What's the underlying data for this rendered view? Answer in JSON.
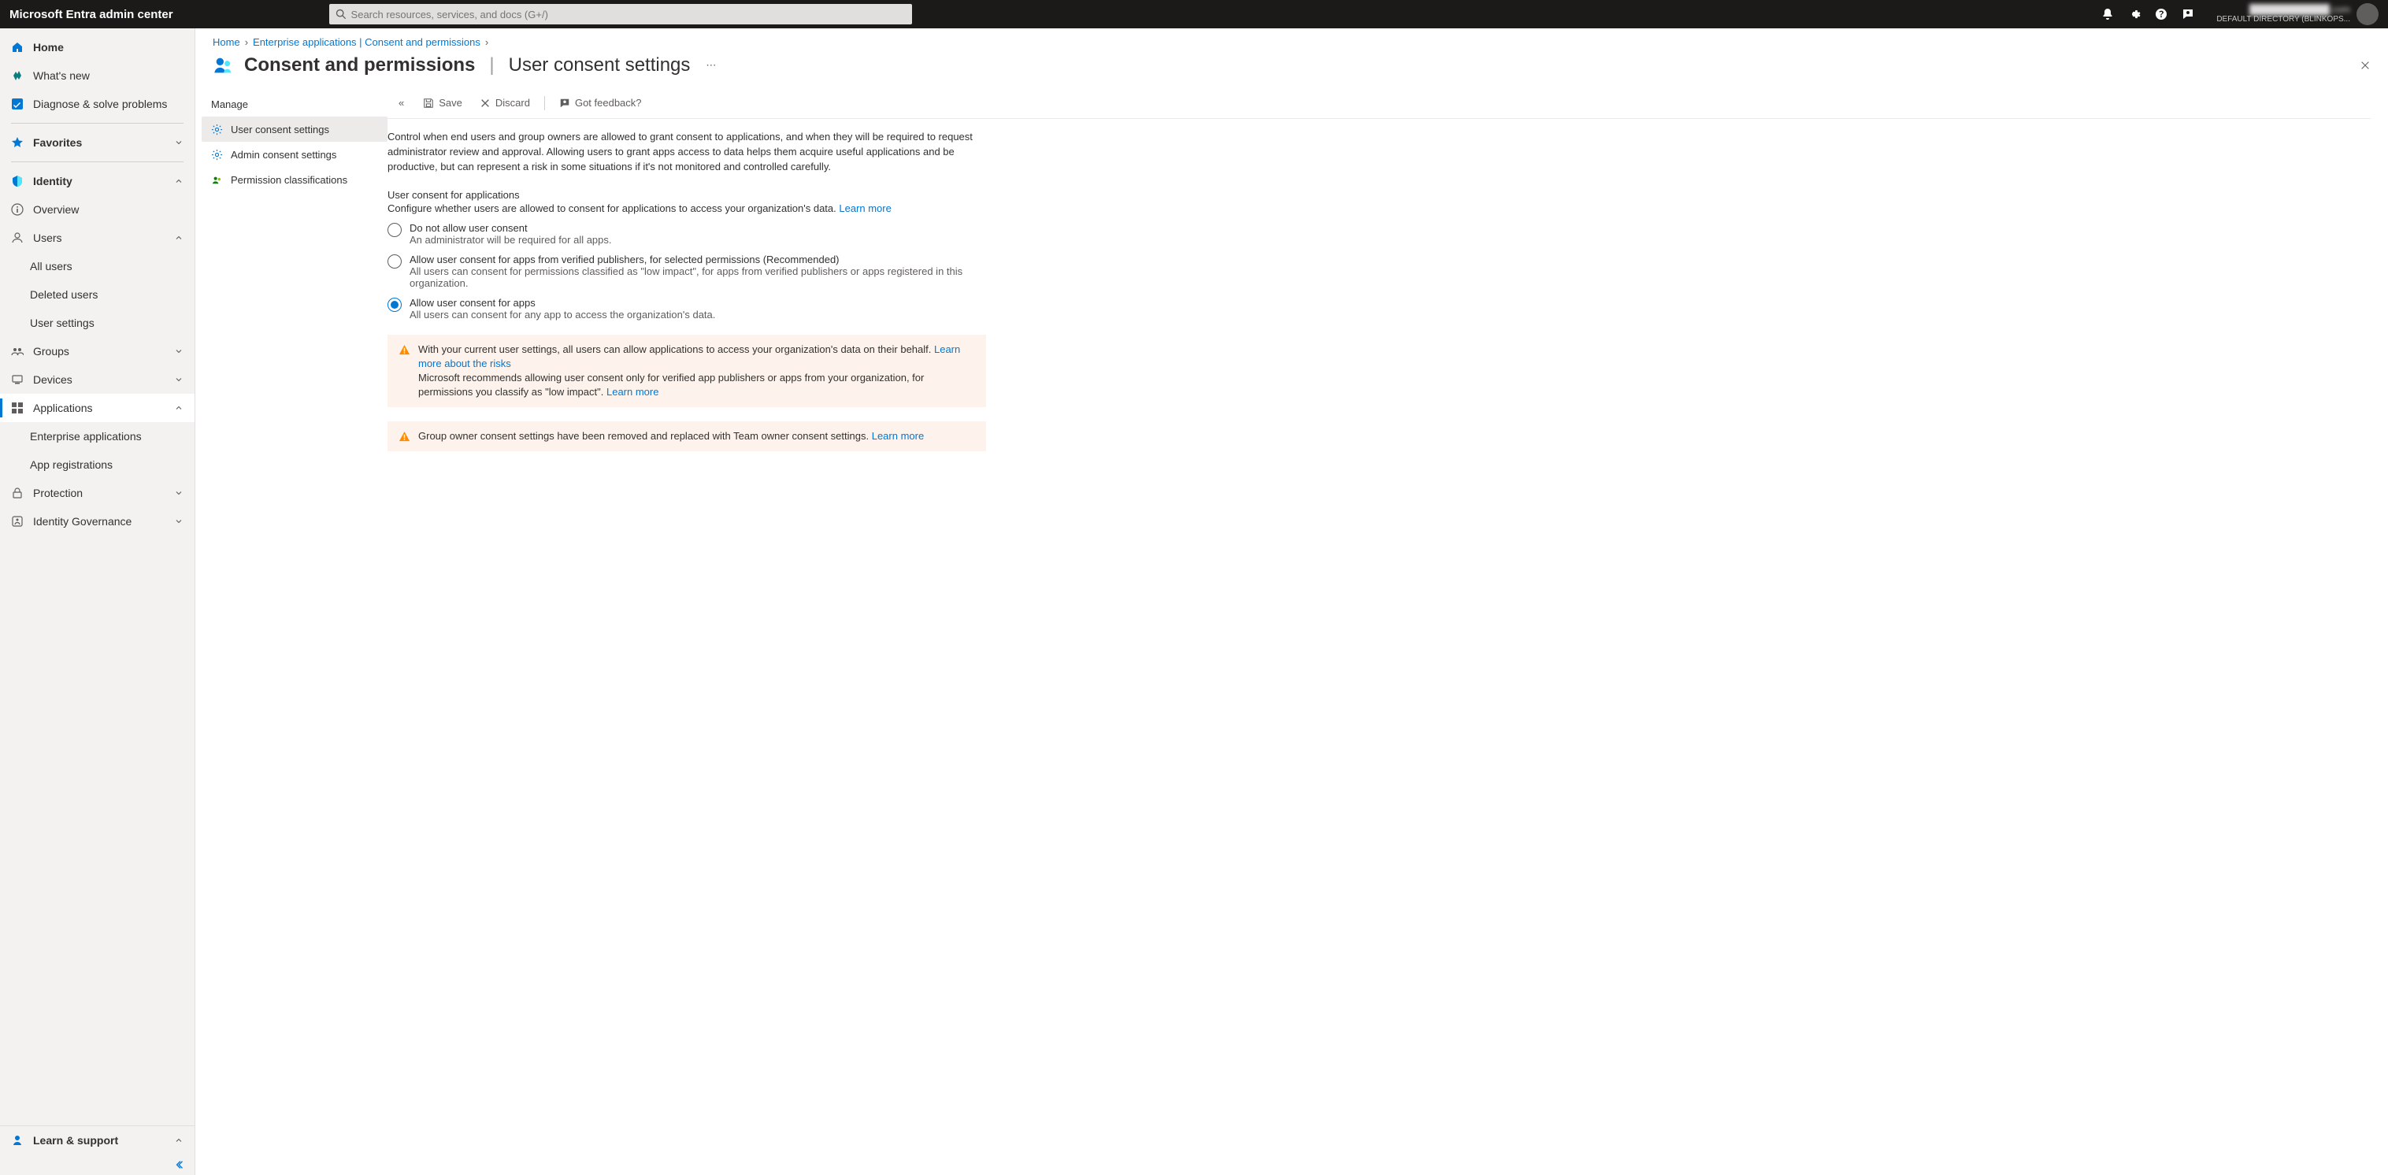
{
  "topbar": {
    "brand": "Microsoft Entra admin center",
    "search_placeholder": "Search resources, services, and docs (G+/)",
    "account_email": "████████████.com",
    "account_dir": "DEFAULT DIRECTORY (BLINKOPS..."
  },
  "sidebar": {
    "home": "Home",
    "whats_new": "What's new",
    "diagnose": "Diagnose & solve problems",
    "favorites": "Favorites",
    "identity": "Identity",
    "overview": "Overview",
    "users": "Users",
    "all_users": "All users",
    "deleted_users": "Deleted users",
    "user_settings": "User settings",
    "groups": "Groups",
    "devices": "Devices",
    "applications": "Applications",
    "enterprise_apps": "Enterprise applications",
    "app_registrations": "App registrations",
    "protection": "Protection",
    "identity_gov": "Identity Governance",
    "learn_support": "Learn & support"
  },
  "crumbs": {
    "home": "Home",
    "eap": "Enterprise applications | Consent and permissions"
  },
  "page": {
    "title": "Consent and permissions",
    "subtitle": "User consent settings"
  },
  "subnav": {
    "header": "Manage",
    "user_consent": "User consent settings",
    "admin_consent": "Admin consent settings",
    "perm_class": "Permission classifications"
  },
  "toolbar": {
    "save": "Save",
    "discard": "Discard",
    "feedback": "Got feedback?"
  },
  "body": {
    "intro": "Control when end users and group owners are allowed to grant consent to applications, and when they will be required to request administrator review and approval. Allowing users to grant apps access to data helps them acquire useful applications and be productive, but can represent a risk in some situations if it's not monitored and controlled carefully.",
    "sec1_h": "User consent for applications",
    "sec1_d": "Configure whether users are allowed to consent for applications to access your organization's data. ",
    "learn_more": "Learn more",
    "opt1_t": "Do not allow user consent",
    "opt1_d": "An administrator will be required for all apps.",
    "opt2_t": "Allow user consent for apps from verified publishers, for selected permissions (Recommended)",
    "opt2_d": "All users can consent for permissions classified as \"low impact\", for apps from verified publishers or apps registered in this organization.",
    "opt3_t": "Allow user consent for apps",
    "opt3_d": "All users can consent for any app to access the organization's data.",
    "warn1_a": "With your current user settings, all users can allow applications to access your organization's data on their behalf. ",
    "warn1_link1": "Learn more about the risks",
    "warn1_b": "Microsoft recommends allowing user consent only for verified app publishers or apps from your organization, for permissions you classify as \"low impact\". ",
    "warn1_link2": "Learn more",
    "warn2_a": "Group owner consent settings have been removed and replaced with Team owner consent settings. ",
    "warn2_link": "Learn more"
  }
}
